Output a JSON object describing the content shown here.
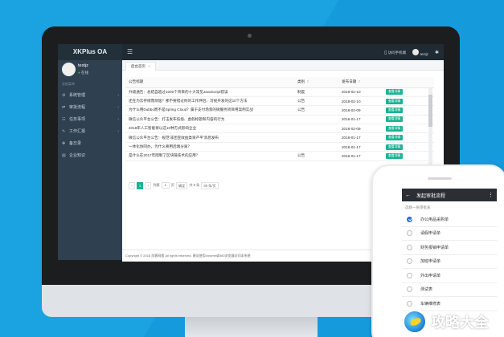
{
  "app": {
    "brand": "XKPlus OA",
    "menu_icon": "hamburger-icon",
    "header_right": {
      "mobile_label": "访问手机端",
      "username": "testjz"
    }
  },
  "user": {
    "name": "testjz",
    "status": "在线"
  },
  "sidebar": {
    "section_label": "导航菜单",
    "items": [
      {
        "label": "系统管理",
        "icon": "gear-icon"
      },
      {
        "label": "审批流程",
        "icon": "flow-icon"
      },
      {
        "label": "任务事项",
        "icon": "tasks-icon"
      },
      {
        "label": "工作汇报",
        "icon": "report-icon"
      },
      {
        "label": "备忘录",
        "icon": "memo-icon"
      },
      {
        "label": "企业知识",
        "icon": "book-icon"
      }
    ]
  },
  "tabs": [
    {
      "label": "后台首页"
    }
  ],
  "table": {
    "columns": [
      "公告标题",
      "类别",
      "发布日期"
    ],
    "view_label": "查看详情",
    "rows": [
      {
        "title": "升级通告：总结自超过1000个项目的十大常见JavaScript错误",
        "category": "制度",
        "date": "2018-02-10"
      },
      {
        "title": "还在为云存储而烦恼？那不要错过你的工作伴侣、可视开发的这10个方法",
        "category": "公告",
        "date": "2018-02-10"
      },
      {
        "title": "为什么用Dubbo而不是Spring Cloud？属于支付场景的微服务项目用案例实战",
        "category": "公告",
        "date": "2018-02-09"
      },
      {
        "title": "微信公众平台公告：打击发布低俗、虚假标题和内容的行为",
        "category": "",
        "date": "2018-01-17"
      },
      {
        "title": "2018年人工智能将以这10种方式影响企业",
        "category": "",
        "date": "2018-02-09"
      },
      {
        "title": "微信公众平台公告：规范'非团宣收益类资产平'消息发布",
        "category": "",
        "date": "2018-01-17"
      },
      {
        "title": "一体化协同办，为什么要用后端分离？",
        "category": "",
        "date": "2018-01-17"
      },
      {
        "title": "是什么在2017年阻制了区块链技术的应用？",
        "category": "公告",
        "date": "2018-01-17"
      }
    ]
  },
  "pager": {
    "prev": "‹",
    "next": "›",
    "current": "1",
    "goto_prefix": "到第",
    "goto_value": "1",
    "goto_suffix": "页",
    "confirm": "确定",
    "total": "共 8 条",
    "page_size": "30 条/页"
  },
  "footer": {
    "text": "Copyright © 2018 炫客网络 All rights reserved.  建议使用chrome或360浏览器访问本系统"
  },
  "mobile": {
    "title": "发起审批流程",
    "hint": "选择一张审批表",
    "options": [
      {
        "label": "办公用品采购单",
        "checked": true
      },
      {
        "label": "请假申请单",
        "checked": false
      },
      {
        "label": "财务报销申请单",
        "checked": false
      },
      {
        "label": "加班申请单",
        "checked": false
      },
      {
        "label": "外出申请单",
        "checked": false
      },
      {
        "label": "测试表",
        "checked": false
      },
      {
        "label": "车辆维修表",
        "checked": false
      }
    ]
  },
  "watermark": {
    "text": "攻略大全"
  },
  "colors": {
    "background": "#1aa3e0",
    "accent": "#1ab394",
    "sidebar": "#2f4050",
    "mobile_check": "#2d6fd6"
  }
}
